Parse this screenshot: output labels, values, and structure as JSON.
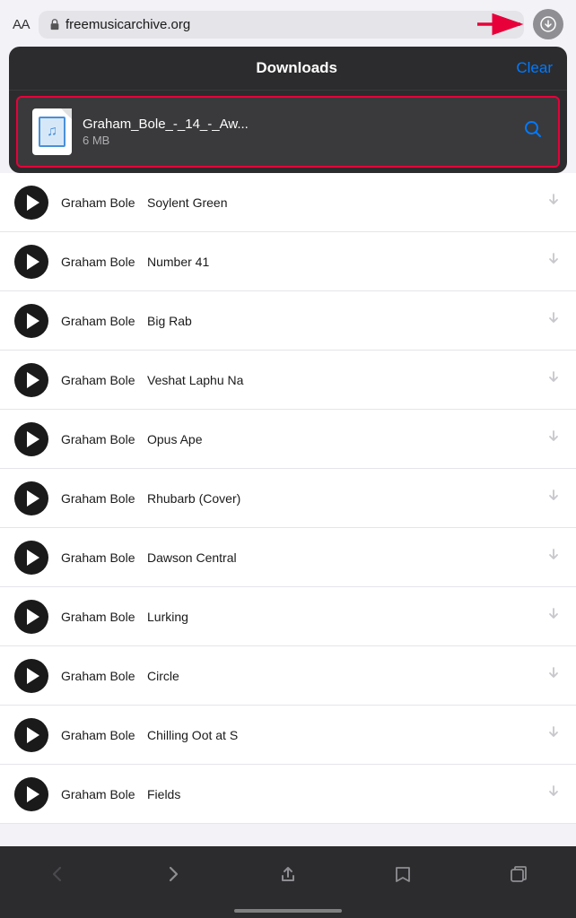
{
  "urlBar": {
    "aa": "AA",
    "url": "freemusicarchive.org",
    "lockIcon": "lock"
  },
  "downloadsPanel": {
    "title": "Downloads",
    "clearLabel": "Clear",
    "item": {
      "filename": "Graham_Bole_-_14_-_Aw...",
      "size": "6 MB"
    }
  },
  "musicList": {
    "rows": [
      {
        "artist": "Graham Bole",
        "title": "Soylent Green"
      },
      {
        "artist": "Graham Bole",
        "title": "Number 41"
      },
      {
        "artist": "Graham Bole",
        "title": "Big Rab"
      },
      {
        "artist": "Graham Bole",
        "title": "Veshat Laphu Na"
      },
      {
        "artist": "Graham Bole",
        "title": "Opus Ape"
      },
      {
        "artist": "Graham Bole",
        "title": "Rhubarb (Cover)"
      },
      {
        "artist": "Graham Bole",
        "title": "Dawson Central"
      },
      {
        "artist": "Graham Bole",
        "title": "Lurking"
      },
      {
        "artist": "Graham Bole",
        "title": "Circle"
      },
      {
        "artist": "Graham Bole",
        "title": "Chilling Oot at S"
      },
      {
        "artist": "Graham Bole",
        "title": "Fields"
      }
    ]
  },
  "toolbar": {
    "back": "‹",
    "forward": "›",
    "share": "share",
    "bookmarks": "bookmarks",
    "tabs": "tabs"
  }
}
